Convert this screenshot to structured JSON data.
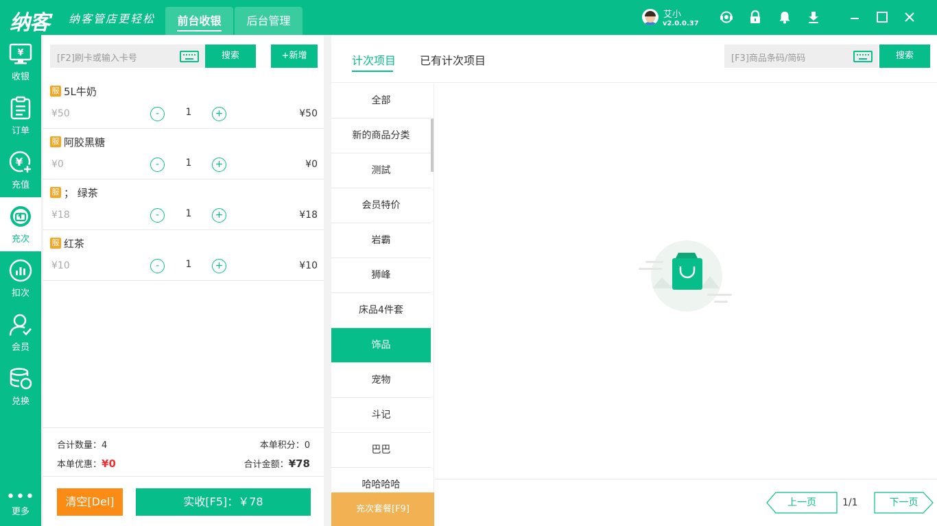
{
  "header": {
    "logo": "纳客",
    "slogan": "纳客管店更轻松",
    "tabs": [
      {
        "label": "前台收银",
        "active": true
      },
      {
        "label": "后台管理",
        "active": false
      }
    ],
    "user": {
      "name": "艾小",
      "version": "v2.0.0.37"
    },
    "icons": [
      "headset-icon",
      "lock-icon",
      "bell-icon",
      "download-icon",
      "minimize-icon",
      "maximize-icon",
      "close-icon"
    ],
    "accent_color": "#07be8a"
  },
  "sidebar": {
    "items": [
      {
        "label": "收银",
        "icon": "cashier-icon",
        "active": false
      },
      {
        "label": "订单",
        "icon": "order-icon",
        "active": false
      },
      {
        "label": "充值",
        "icon": "recharge-icon",
        "active": false
      },
      {
        "label": "充次",
        "icon": "times-recharge-icon",
        "active": true
      },
      {
        "label": "扣次",
        "icon": "deduct-icon",
        "active": false
      },
      {
        "label": "会员",
        "icon": "member-icon",
        "active": false
      },
      {
        "label": "兑换",
        "icon": "exchange-icon",
        "active": false
      }
    ],
    "more_label": "更多"
  },
  "cart": {
    "search_placeholder": "[F2]刷卡或输入卡号",
    "search_button": "搜索",
    "add_button": "+新增",
    "items": [
      {
        "tag": "服",
        "name": "5L牛奶",
        "price": "¥50",
        "qty": "1",
        "total": "¥50"
      },
      {
        "tag": "服",
        "name": "阿胶黑糖",
        "price": "¥0",
        "qty": "1",
        "total": "¥0"
      },
      {
        "tag": "服",
        "name": "；  绿茶",
        "price": "¥18",
        "qty": "1",
        "total": "¥18"
      },
      {
        "tag": "服",
        "name": "红茶",
        "price": "¥10",
        "qty": "1",
        "total": "¥10"
      }
    ],
    "summary": {
      "total_qty_label": "合计数量：",
      "total_qty": "4",
      "points_label": "本单积分：",
      "points": "0",
      "discount_label": "本单优惠：",
      "discount": "¥0",
      "amount_label": "合计金额：",
      "amount": "¥78"
    },
    "clear_button": "清空[Del]",
    "pay_button": "实收[F5]：￥78"
  },
  "main": {
    "tabs": [
      {
        "label": "计次项目",
        "active": true
      },
      {
        "label": "已有计次项目",
        "active": false
      }
    ],
    "search_placeholder": "[F3]商品条码/简码",
    "search_button": "搜索",
    "categories": [
      {
        "label": "全部",
        "active": false
      },
      {
        "label": "新的商品分类",
        "active": false
      },
      {
        "label": "测試",
        "active": false
      },
      {
        "label": "会员特价",
        "active": false
      },
      {
        "label": "岩霸",
        "active": false
      },
      {
        "label": "狮峰",
        "active": false
      },
      {
        "label": "床品4件套",
        "active": false
      },
      {
        "label": "饰品",
        "active": true
      },
      {
        "label": "宠物",
        "active": false
      },
      {
        "label": "斗记",
        "active": false
      },
      {
        "label": "巴巴",
        "active": false
      },
      {
        "label": "哈哈哈哈",
        "active": false
      }
    ],
    "package_button": "充次套餐[F9]",
    "empty_icon": "empty-bag-icon",
    "pager": {
      "prev": "上一页",
      "page": "1/1",
      "next": "下一页"
    }
  }
}
